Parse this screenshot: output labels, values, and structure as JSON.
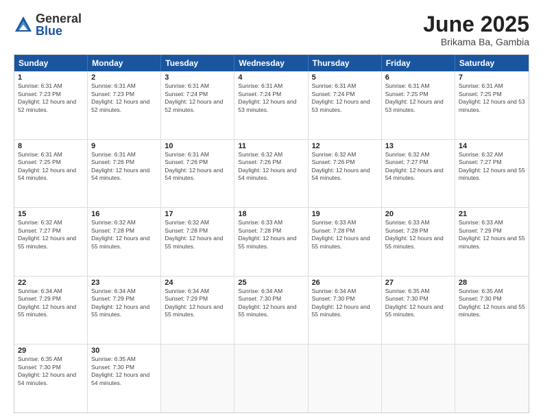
{
  "logo": {
    "general": "General",
    "blue": "Blue"
  },
  "title": "June 2025",
  "location": "Brikama Ba, Gambia",
  "days": [
    "Sunday",
    "Monday",
    "Tuesday",
    "Wednesday",
    "Thursday",
    "Friday",
    "Saturday"
  ],
  "rows": [
    [
      {
        "day": "1",
        "sunrise": "6:31 AM",
        "sunset": "7:23 PM",
        "daylight": "12 hours and 52 minutes."
      },
      {
        "day": "2",
        "sunrise": "6:31 AM",
        "sunset": "7:23 PM",
        "daylight": "12 hours and 52 minutes."
      },
      {
        "day": "3",
        "sunrise": "6:31 AM",
        "sunset": "7:24 PM",
        "daylight": "12 hours and 52 minutes."
      },
      {
        "day": "4",
        "sunrise": "6:31 AM",
        "sunset": "7:24 PM",
        "daylight": "12 hours and 53 minutes."
      },
      {
        "day": "5",
        "sunrise": "6:31 AM",
        "sunset": "7:24 PM",
        "daylight": "12 hours and 53 minutes."
      },
      {
        "day": "6",
        "sunrise": "6:31 AM",
        "sunset": "7:25 PM",
        "daylight": "12 hours and 53 minutes."
      },
      {
        "day": "7",
        "sunrise": "6:31 AM",
        "sunset": "7:25 PM",
        "daylight": "12 hours and 53 minutes."
      }
    ],
    [
      {
        "day": "8",
        "sunrise": "6:31 AM",
        "sunset": "7:25 PM",
        "daylight": "12 hours and 54 minutes."
      },
      {
        "day": "9",
        "sunrise": "6:31 AM",
        "sunset": "7:26 PM",
        "daylight": "12 hours and 54 minutes."
      },
      {
        "day": "10",
        "sunrise": "6:31 AM",
        "sunset": "7:26 PM",
        "daylight": "12 hours and 54 minutes."
      },
      {
        "day": "11",
        "sunrise": "6:32 AM",
        "sunset": "7:26 PM",
        "daylight": "12 hours and 54 minutes."
      },
      {
        "day": "12",
        "sunrise": "6:32 AM",
        "sunset": "7:26 PM",
        "daylight": "12 hours and 54 minutes."
      },
      {
        "day": "13",
        "sunrise": "6:32 AM",
        "sunset": "7:27 PM",
        "daylight": "12 hours and 54 minutes."
      },
      {
        "day": "14",
        "sunrise": "6:32 AM",
        "sunset": "7:27 PM",
        "daylight": "12 hours and 55 minutes."
      }
    ],
    [
      {
        "day": "15",
        "sunrise": "6:32 AM",
        "sunset": "7:27 PM",
        "daylight": "12 hours and 55 minutes."
      },
      {
        "day": "16",
        "sunrise": "6:32 AM",
        "sunset": "7:28 PM",
        "daylight": "12 hours and 55 minutes."
      },
      {
        "day": "17",
        "sunrise": "6:32 AM",
        "sunset": "7:28 PM",
        "daylight": "12 hours and 55 minutes."
      },
      {
        "day": "18",
        "sunrise": "6:33 AM",
        "sunset": "7:28 PM",
        "daylight": "12 hours and 55 minutes."
      },
      {
        "day": "19",
        "sunrise": "6:33 AM",
        "sunset": "7:28 PM",
        "daylight": "12 hours and 55 minutes."
      },
      {
        "day": "20",
        "sunrise": "6:33 AM",
        "sunset": "7:28 PM",
        "daylight": "12 hours and 55 minutes."
      },
      {
        "day": "21",
        "sunrise": "6:33 AM",
        "sunset": "7:29 PM",
        "daylight": "12 hours and 55 minutes."
      }
    ],
    [
      {
        "day": "22",
        "sunrise": "6:34 AM",
        "sunset": "7:29 PM",
        "daylight": "12 hours and 55 minutes."
      },
      {
        "day": "23",
        "sunrise": "6:34 AM",
        "sunset": "7:29 PM",
        "daylight": "12 hours and 55 minutes."
      },
      {
        "day": "24",
        "sunrise": "6:34 AM",
        "sunset": "7:29 PM",
        "daylight": "12 hours and 55 minutes."
      },
      {
        "day": "25",
        "sunrise": "6:34 AM",
        "sunset": "7:30 PM",
        "daylight": "12 hours and 55 minutes."
      },
      {
        "day": "26",
        "sunrise": "6:34 AM",
        "sunset": "7:30 PM",
        "daylight": "12 hours and 55 minutes."
      },
      {
        "day": "27",
        "sunrise": "6:35 AM",
        "sunset": "7:30 PM",
        "daylight": "12 hours and 55 minutes."
      },
      {
        "day": "28",
        "sunrise": "6:35 AM",
        "sunset": "7:30 PM",
        "daylight": "12 hours and 55 minutes."
      }
    ],
    [
      {
        "day": "29",
        "sunrise": "6:35 AM",
        "sunset": "7:30 PM",
        "daylight": "12 hours and 54 minutes."
      },
      {
        "day": "30",
        "sunrise": "6:35 AM",
        "sunset": "7:30 PM",
        "daylight": "12 hours and 54 minutes."
      },
      {
        "day": "",
        "sunrise": "",
        "sunset": "",
        "daylight": ""
      },
      {
        "day": "",
        "sunrise": "",
        "sunset": "",
        "daylight": ""
      },
      {
        "day": "",
        "sunrise": "",
        "sunset": "",
        "daylight": ""
      },
      {
        "day": "",
        "sunrise": "",
        "sunset": "",
        "daylight": ""
      },
      {
        "day": "",
        "sunrise": "",
        "sunset": "",
        "daylight": ""
      }
    ]
  ],
  "labels": {
    "sunrise": "Sunrise:",
    "sunset": "Sunset:",
    "daylight": "Daylight:"
  }
}
